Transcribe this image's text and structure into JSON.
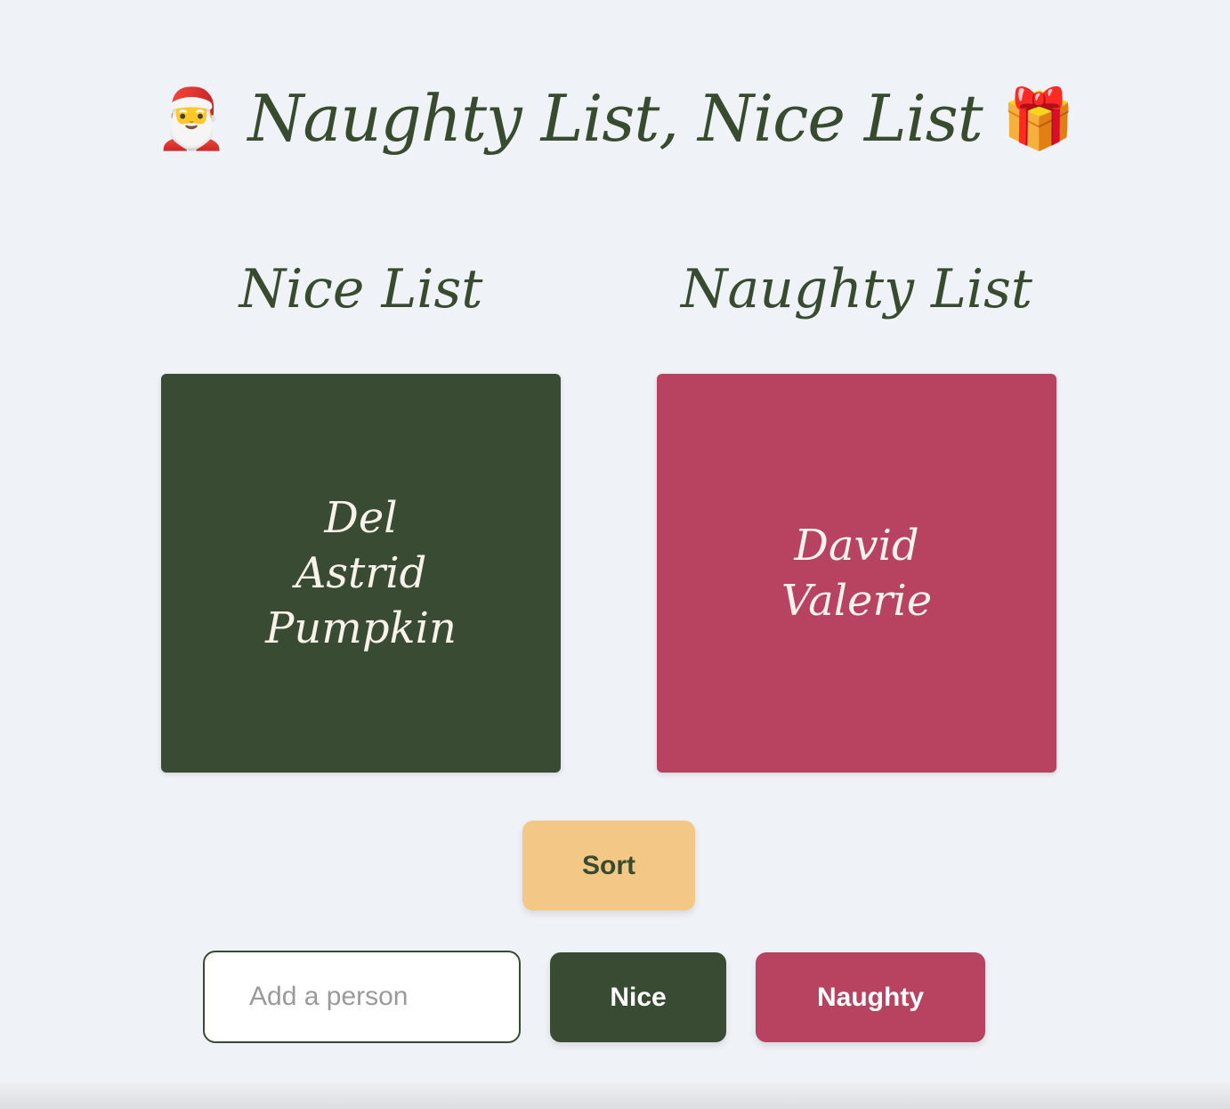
{
  "header": {
    "title": "Naughty List, Nice List",
    "left_emoji": "🎅",
    "right_emoji": "🎁",
    "left_icon": "santa-icon",
    "right_icon": "gift-icon"
  },
  "nice_list": {
    "heading": "Nice List",
    "names": [
      "Del",
      "Astrid",
      "Pumpkin"
    ],
    "color": "#3a4b33"
  },
  "naughty_list": {
    "heading": "Naughty List",
    "names": [
      "David",
      "Valerie"
    ],
    "color": "#b84361"
  },
  "controls": {
    "sort_label": "Sort",
    "input_placeholder": "Add a person",
    "input_value": "",
    "nice_label": "Nice",
    "naughty_label": "Naughty",
    "sort_color": "#f3c785"
  }
}
